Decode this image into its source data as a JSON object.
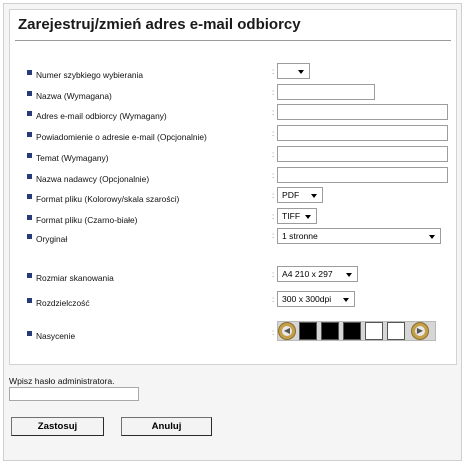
{
  "page_title": "Zarejestruj/zmień adres e-mail odbiorcy",
  "separator": ":",
  "fields": [
    {
      "label": "Numer szybkiego wybierania",
      "value": ""
    },
    {
      "label": "Nazwa (Wymagana)",
      "value": ""
    },
    {
      "label": "Adres e-mail odbiorcy (Wymagany)",
      "value": ""
    },
    {
      "label": "Powiadomienie o adresie e-mail (Opcjonalnie)",
      "value": ""
    },
    {
      "label": "Temat (Wymagany)",
      "value": ""
    },
    {
      "label": "Nazwa nadawcy (Opcjonalnie)",
      "value": ""
    },
    {
      "label": "Format pliku (Kolorowy/skala szarości)",
      "value": "PDF"
    },
    {
      "label": "Format pliku (Czarno-białe)",
      "value": "TIFF"
    },
    {
      "label": "Oryginał",
      "value": "1 stronne"
    },
    {
      "label": "Rozmiar skanowania",
      "value": "A4 210 x 297"
    },
    {
      "label": "Rozdzielczość",
      "value": "300 x 300dpi"
    },
    {
      "label": "Nasycenie",
      "value": ""
    }
  ],
  "saturation": {
    "levels": 5,
    "selected": 3,
    "filled_color": "#000000",
    "empty_color": "#ffffff",
    "arrow_color": "#c4a04a"
  },
  "password": {
    "label": "Wpisz hasło administratora.",
    "value": ""
  },
  "buttons": {
    "apply": "Zastosuj",
    "cancel": "Anuluj"
  },
  "colors": {
    "bullet": "#273a7a",
    "background": "#f5f5f5"
  }
}
